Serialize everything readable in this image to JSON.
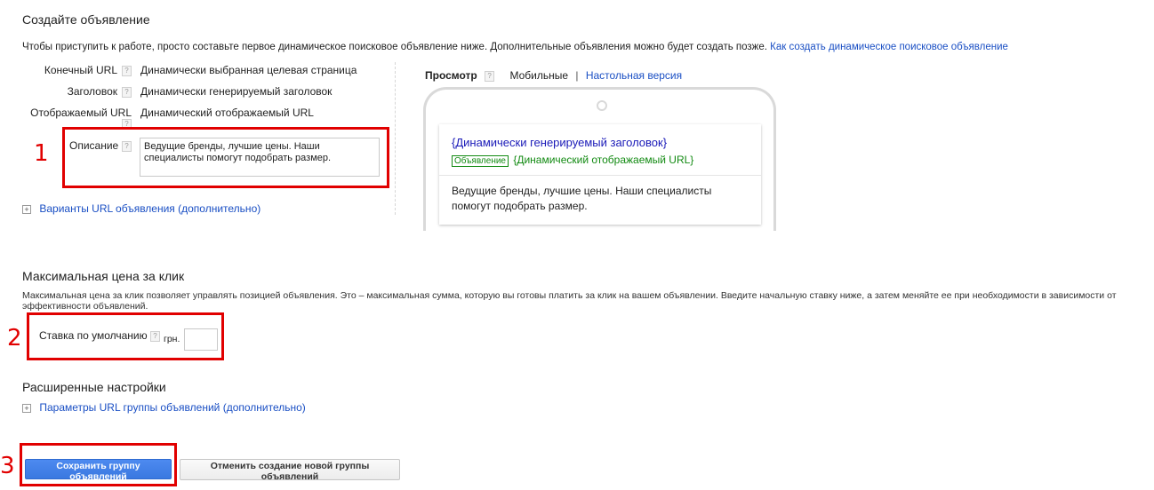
{
  "create_ad": {
    "title": "Создайте объявление",
    "intro": "Чтобы приступить к работе, просто составьте первое динамическое поисковое объявление ниже. Дополнительные объявления можно будет создать позже.",
    "intro_link": "Как создать динамическое поисковое объявление",
    "fields": [
      {
        "label": "Конечный URL",
        "value": "Динамически выбранная целевая страница"
      },
      {
        "label": "Заголовок",
        "value": "Динамически генерируемый заголовок"
      },
      {
        "label": "Отображаемый URL",
        "value": "Динамический отображаемый URL"
      }
    ],
    "description_label": "Описание",
    "description_value": "Ведущие бренды, лучшие цены. Наши специалисты помогут подобрать размер.",
    "url_options_link": "Варианты URL объявления (дополнительно)"
  },
  "preview": {
    "label": "Просмотр",
    "mobile": "Мобильные",
    "separator": "|",
    "desktop": "Настольная версия",
    "ad_headline": "{Динамически генерируемый заголовок}",
    "ad_badge": "Объявление",
    "ad_display_url": "{Динамический отображаемый URL}",
    "ad_description": "Ведущие бренды, лучшие цены. Наши специалисты помогут подобрать размер."
  },
  "max_cpc": {
    "title": "Максимальная цена за клик",
    "description": "Максимальная цена за клик позволяет управлять позицией объявления. Это – максимальная сумма, которую вы готовы платить за клик на вашем объявлении. Введите начальную ставку ниже, а затем меняйте ее при необходимости в зависимости от эффективности объявлений.",
    "default_bid_label": "Ставка по умолчанию",
    "currency": "грн.",
    "bid_value": ""
  },
  "advanced": {
    "title": "Расширенные настройки",
    "url_params_link": "Параметры URL группы объявлений (дополнительно)"
  },
  "buttons": {
    "save": "Сохранить группу объявлений",
    "cancel": "Отменить создание новой группы объявлений"
  },
  "markers": {
    "one": "1",
    "two": "2",
    "three": "3"
  },
  "help_glyph": "?",
  "expand_glyph": "+",
  "colors": {
    "link": "#1a4fc4",
    "highlight": "#e10000",
    "primary_button": "#3f7ee8",
    "ad_green": "#128a12"
  }
}
